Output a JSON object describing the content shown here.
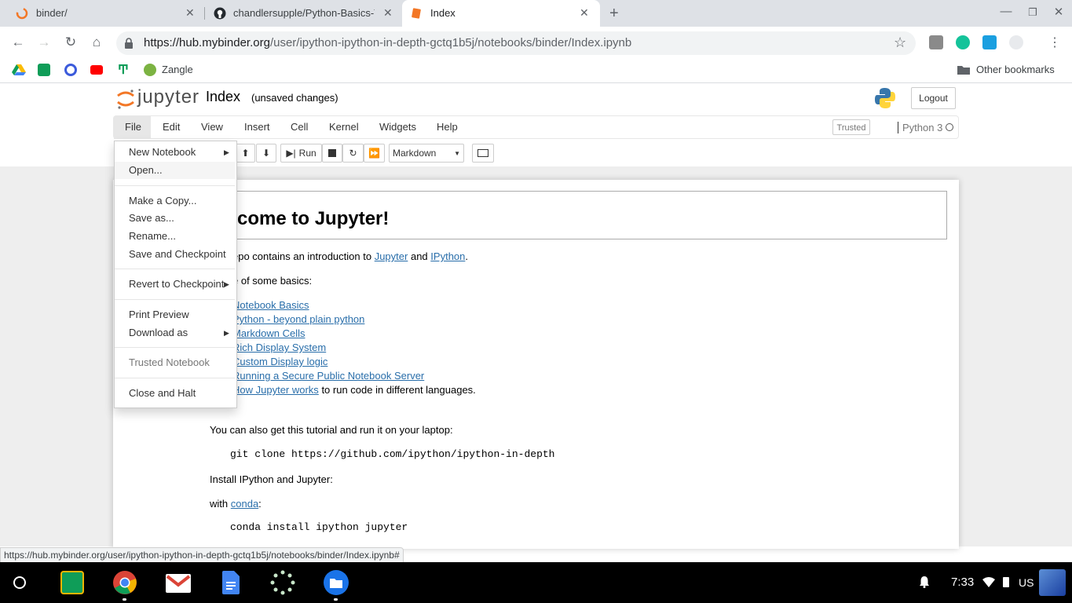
{
  "browser": {
    "tabs": [
      {
        "title": "binder/"
      },
      {
        "title": "chandlersupple/Python-Basics-T"
      },
      {
        "title": "Index"
      }
    ],
    "url_host": "https://hub.mybinder.org",
    "url_path": "/user/ipython-ipython-in-depth-gctq1b5j/notebooks/binder/Index.ipynb",
    "bookmarks": [
      {
        "label": "Zangle"
      }
    ],
    "other_bookmarks": "Other bookmarks",
    "status_url": "https://hub.mybinder.org/user/ipython-ipython-in-depth-gctq1b5j/notebooks/binder/Index.ipynb#"
  },
  "jupyter": {
    "logo_text": "jupyter",
    "notebook_name": "Index",
    "save_status": "(unsaved changes)",
    "logout_label": "Logout",
    "menus": [
      "File",
      "Edit",
      "View",
      "Insert",
      "Cell",
      "Kernel",
      "Widgets",
      "Help"
    ],
    "trusted_label": "Trusted",
    "kernel_name": "Python 3",
    "run_label": "Run",
    "cell_type": "Markdown"
  },
  "file_menu": {
    "items": [
      {
        "label": "New Notebook"
      },
      {
        "label": "Open..."
      },
      {
        "label": "Make a Copy..."
      },
      {
        "label": "Save as..."
      },
      {
        "label": "Rename..."
      },
      {
        "label": "Save and Checkpoint"
      },
      {
        "label": "Revert to Checkpoint"
      },
      {
        "label": "Print Preview"
      },
      {
        "label": "Download as"
      },
      {
        "label": "Trusted Notebook"
      },
      {
        "label": "Close and Halt"
      }
    ]
  },
  "notebook": {
    "heading": "elcome to Jupyter!",
    "intro_prefix": "epo contains an introduction to",
    "jupyter_link": "Jupyter",
    "and": "and",
    "ipython_link": "IPython",
    "basics_prefix": "e of some basics:",
    "links": [
      "Notebook Basics",
      "Python - beyond plain python",
      "Markdown Cells",
      "Rich Display System",
      "Custom Display logic",
      "Running a Secure Public Notebook Server",
      "How Jupyter works"
    ],
    "how_suffix": "to run code in different languages.",
    "laptop_text": "You can also get this tutorial and run it on your laptop:",
    "git_cmd": "git clone https://github.com/ipython/ipython-in-depth",
    "install_text": "Install IPython and Jupyter:",
    "with_text": "with",
    "conda_link": "conda",
    "conda_cmd": "conda install ipython jupyter"
  },
  "shelf": {
    "time": "7:33",
    "locale": "US"
  },
  "colors": {
    "jupyter_orange": "#f37726",
    "link": "#296eaa",
    "chrome_tabstrip": "#dee1e6"
  }
}
